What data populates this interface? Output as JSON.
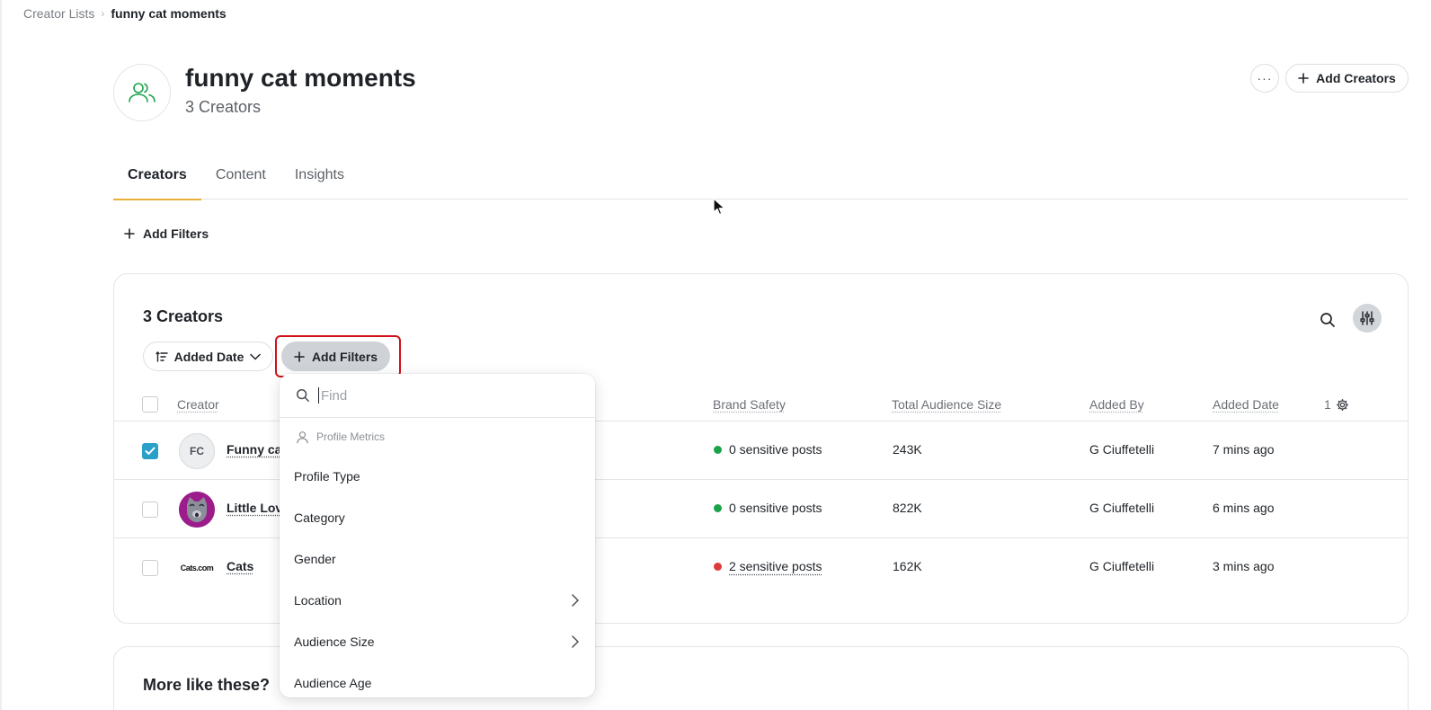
{
  "breadcrumb": {
    "root": "Creator Lists",
    "separator": "›",
    "current": "funny cat moments"
  },
  "header": {
    "title": "funny cat moments",
    "subtitle": "3 Creators",
    "more_label": "···",
    "add_creators_label": "Add Creators"
  },
  "tabs": [
    {
      "label": "Creators",
      "active": true
    },
    {
      "label": "Content",
      "active": false
    },
    {
      "label": "Insights",
      "active": false
    }
  ],
  "top_filters": {
    "label": "Add Filters"
  },
  "table_card": {
    "title": "3 Creators",
    "sort_label": "Added Date",
    "add_filters_label": "Add Filters",
    "columns": {
      "creator": "Creator",
      "brand_safety": "Brand Safety",
      "audience": "Total Audience Size",
      "added_by": "Added By",
      "added_date": "Added Date",
      "extra": "1"
    },
    "rows": [
      {
        "initials": "FC",
        "name": "Funny ca",
        "checked": true,
        "safety": "0 sensitive posts",
        "safety_status": "green",
        "audience": "243K",
        "added_by": "G Ciuffetelli",
        "added_date": "7 mins ago"
      },
      {
        "initials": "",
        "name": "Little Lov",
        "checked": false,
        "safety": "0 sensitive posts",
        "safety_status": "green",
        "audience": "822K",
        "added_by": "G Ciuffetelli",
        "added_date": "6 mins ago"
      },
      {
        "initials": "",
        "logo_text": "Cats.com",
        "name": "Cats",
        "checked": false,
        "safety": "2 sensitive posts",
        "safety_status": "red",
        "audience": "162K",
        "added_by": "G Ciuffetelli",
        "added_date": "3 mins ago"
      }
    ]
  },
  "filter_dropdown": {
    "search_placeholder": "Find",
    "section_label": "Profile Metrics",
    "items": [
      {
        "label": "Profile Type",
        "has_submenu": false
      },
      {
        "label": "Category",
        "has_submenu": false
      },
      {
        "label": "Gender",
        "has_submenu": false
      },
      {
        "label": "Location",
        "has_submenu": true
      },
      {
        "label": "Audience Size",
        "has_submenu": true
      },
      {
        "label": "Audience Age",
        "has_submenu": false
      }
    ]
  },
  "more_like": {
    "title": "More like these?"
  },
  "colors": {
    "accent_tab": "#e8b13a",
    "highlight_border": "#d0121a",
    "checkbox": "#2a9fc8",
    "safe": "#1aa34a",
    "unsafe": "#dc3b3b",
    "list_icon": "#1aa34a"
  },
  "icons": [
    "users-icon",
    "plus-icon",
    "sort-icon",
    "chevron-down-icon",
    "search-icon",
    "sliders-icon",
    "gear-icon",
    "user-icon",
    "chevron-right-icon",
    "check-icon",
    "cursor-icon"
  ]
}
